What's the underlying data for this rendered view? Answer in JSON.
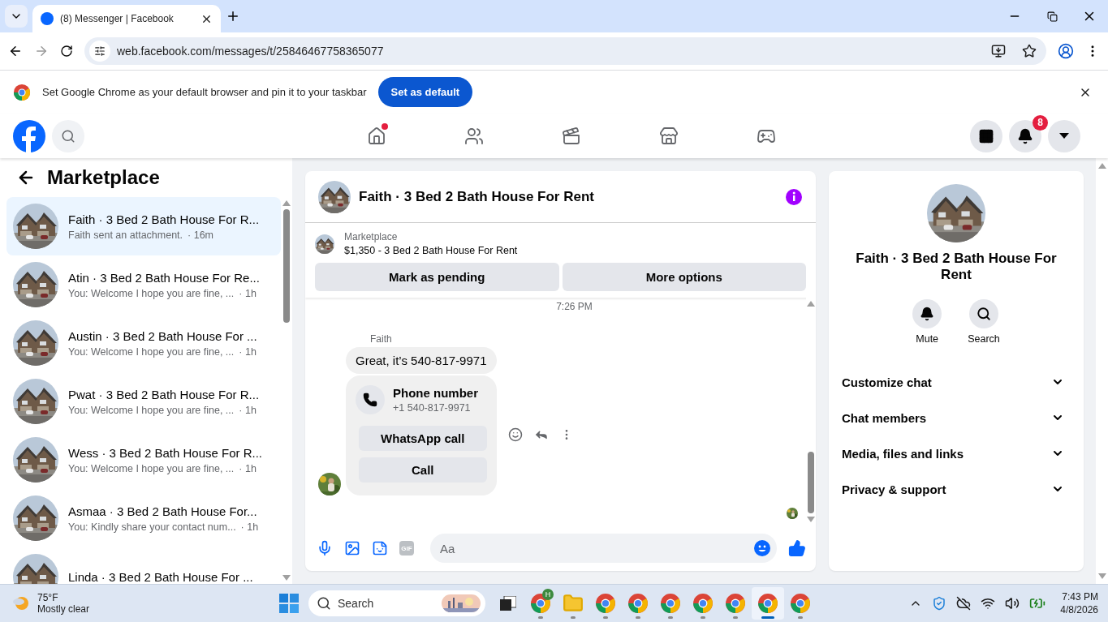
{
  "browser": {
    "tabs": [
      {
        "title": "(8) Messenger | Facebook",
        "selected": true
      }
    ],
    "url": "web.facebook.com/messages/t/25846467758365077",
    "infobar": {
      "message": "Set Google Chrome as your default browser and pin it to your taskbar",
      "button": "Set as default"
    }
  },
  "fb_header": {
    "nav": [
      {
        "kind": "home",
        "dot": true
      },
      {
        "kind": "friends",
        "dot": false
      },
      {
        "kind": "video",
        "dot": false
      },
      {
        "kind": "marketplace",
        "dot": false
      },
      {
        "kind": "gaming",
        "dot": false
      }
    ],
    "notification_count": "8"
  },
  "sidebar": {
    "title": "Marketplace",
    "conversations": [
      {
        "title": "Faith · 3 Bed 2 Bath House For R...",
        "preview": "Faith sent an attachment.",
        "time": "· 16m",
        "selected": true
      },
      {
        "title": "Atin · 3 Bed 2 Bath House For Re...",
        "preview": "You: Welcome I hope you are fine, ...",
        "time": "· 1h",
        "selected": false
      },
      {
        "title": "Austin · 3 Bed 2 Bath House For ...",
        "preview": "You: Welcome I hope you are fine, ...",
        "time": "· 1h",
        "selected": false
      },
      {
        "title": "Pwat · 3 Bed 2 Bath House For R...",
        "preview": "You: Welcome I hope you are fine, ...",
        "time": "· 1h",
        "selected": false
      },
      {
        "title": "Wess · 3 Bed 2 Bath House For R...",
        "preview": "You: Welcome I hope you are fine, ...",
        "time": "· 1h",
        "selected": false
      },
      {
        "title": "Asmaa · 3 Bed 2 Bath House For...",
        "preview": "You: Kindly share your contact num...",
        "time": "· 1h",
        "selected": false
      },
      {
        "title": "Linda · 3 Bed 2 Bath House For ..."
      }
    ]
  },
  "chat": {
    "title": "Faith · 3 Bed 2 Bath House For Rent",
    "listing": {
      "label": "Marketplace",
      "title": "$1,350 - 3 Bed 2 Bath House For Rent"
    },
    "actions": [
      "Mark as pending",
      "More options"
    ],
    "timestamp": "7:26 PM",
    "sender": "Faith",
    "message": "Great, it’s 540-817-9971",
    "phone_card": {
      "title": "Phone number",
      "number": "+1 540-817-9971",
      "buttons": [
        "WhatsApp call",
        "Call"
      ]
    },
    "composer": {
      "placeholder": "Aa",
      "gif_label": "GIF"
    }
  },
  "details": {
    "title": "Faith · 3 Bed 2 Bath House For Rent",
    "actions": [
      {
        "kind": "mute",
        "label": "Mute"
      },
      {
        "kind": "search",
        "label": "Search"
      }
    ],
    "sections": [
      {
        "label": "Customize chat",
        "expanded": false
      },
      {
        "label": "Chat members",
        "expanded": false
      },
      {
        "label": "Media, files and links",
        "expanded": false
      },
      {
        "label": "Privacy & support",
        "expanded": false
      }
    ]
  },
  "taskbar": {
    "weather": {
      "temperature": "75°F",
      "condition": "Mostly clear"
    },
    "search_placeholder": "Search",
    "apps": [
      {
        "kind": "chrome",
        "badge": "H",
        "selected": false
      },
      {
        "kind": "explorer",
        "selected": false
      },
      {
        "kind": "chrome",
        "selected": false
      },
      {
        "kind": "chrome",
        "selected": false
      },
      {
        "kind": "chrome",
        "selected": false
      },
      {
        "kind": "chrome",
        "selected": false
      },
      {
        "kind": "chrome",
        "selected": false
      },
      {
        "kind": "chrome",
        "selected": true
      },
      {
        "kind": "chrome",
        "selected": false
      }
    ],
    "clock": {
      "time": "7:43 PM",
      "date": "4/8/2026"
    }
  }
}
